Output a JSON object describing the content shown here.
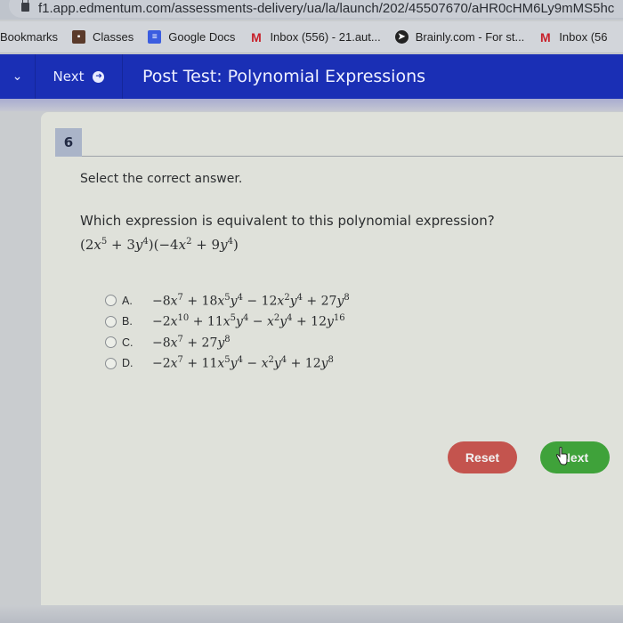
{
  "browser": {
    "url": "f1.app.edmentum.com/assessments-delivery/ua/la/launch/202/45507670/aHR0cHM6Ly9mMS5hc",
    "bookmarks_label": "Bookmarks",
    "bookmarks": [
      {
        "label": "Classes",
        "icon": "classroom-icon"
      },
      {
        "label": "Google Docs",
        "icon": "google-docs-icon"
      },
      {
        "label": "Inbox (556) - 21.aut...",
        "icon": "gmail-icon"
      },
      {
        "label": "Brainly.com - For st...",
        "icon": "brainly-icon"
      },
      {
        "label": "Inbox (56",
        "icon": "gmail-icon"
      }
    ]
  },
  "appbar": {
    "next_label": "Next",
    "title": "Post Test: Polynomial Expressions",
    "color": "#1a2fb5"
  },
  "question": {
    "number": "6",
    "instruction": "Select the correct answer.",
    "prompt": "Which expression is equivalent to this polynomial expression?",
    "expression": "(2x^5 + 3y^4)(-4x^2 + 9y^4)",
    "options": [
      {
        "letter": "A.",
        "text": "-8x^7 + 18x^5y^4 - 12x^2y^4 + 27y^8",
        "selected": false
      },
      {
        "letter": "B.",
        "text": "-2x^10 + 11x^5y^4 - x^2y^4 + 12y^16",
        "selected": false
      },
      {
        "letter": "C.",
        "text": "-8x^7 + 27y^8",
        "selected": false
      },
      {
        "letter": "D.",
        "text": "-2x^7 + 11x^5y^4 - x^2y^4 + 12y^8",
        "selected": false
      }
    ]
  },
  "buttons": {
    "reset_label": "Reset",
    "next_label": "Next",
    "reset_color": "#c4544e",
    "next_color": "#3fa23a"
  }
}
